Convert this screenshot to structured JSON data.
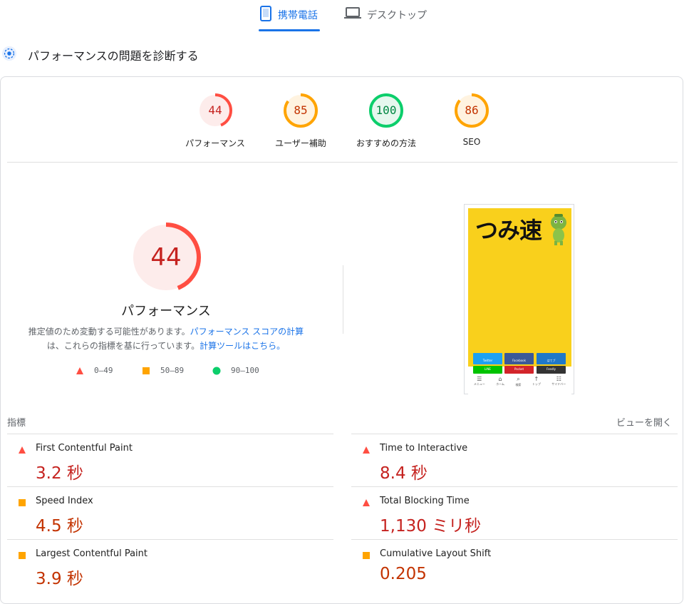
{
  "tabs": {
    "mobile_label": "携帯電話",
    "desktop_label": "デスクトップ"
  },
  "diagnose": {
    "title": "パフォーマンスの問題を診断する"
  },
  "categories": [
    {
      "score": "44",
      "label": "パフォーマンス",
      "rating": "fail",
      "fraction": 0.44
    },
    {
      "score": "85",
      "label": "ユーザー補助",
      "rating": "average",
      "fraction": 0.85
    },
    {
      "score": "100",
      "label": "おすすめの方法",
      "rating": "pass",
      "fraction": 1.0
    },
    {
      "score": "86",
      "label": "SEO",
      "rating": "average",
      "fraction": 0.86
    }
  ],
  "performance": {
    "score": "44",
    "fraction": 0.44,
    "label": "パフォーマンス",
    "desc_line1": "推定値のため変動する可能性があります。",
    "desc_link1": "パフォーマンス スコアの計算",
    "desc_line2": "は、これらの指標を基に行っています。",
    "desc_link2": "計算ツールはこちら。"
  },
  "legend": {
    "fail": "0–49",
    "average": "50–89",
    "pass": "90–100"
  },
  "screenshot": {
    "site_title": "つみ速",
    "share_buttons": [
      "Twitter",
      "Facebook",
      "はてブ",
      "LINE",
      "Pocket",
      "Feedly"
    ],
    "nav": [
      "メニュー",
      "ホーム",
      "検索",
      "トップ",
      "サイドバー"
    ]
  },
  "metrics": {
    "header": "指標",
    "expand_label": "ビューを開く",
    "items": [
      {
        "name": "First Contentful Paint",
        "value": "3.2 秒",
        "rating": "fail"
      },
      {
        "name": "Time to Interactive",
        "value": "8.4 秒",
        "rating": "fail"
      },
      {
        "name": "Speed Index",
        "value": "4.5 秒",
        "rating": "average"
      },
      {
        "name": "Total Blocking Time",
        "value": "1,130 ミリ秒",
        "rating": "fail"
      },
      {
        "name": "Largest Contentful Paint",
        "value": "3.9 秒",
        "rating": "average"
      },
      {
        "name": "Cumulative Layout Shift",
        "value": "0.205",
        "rating": "average"
      }
    ]
  },
  "colors": {
    "fail": "#ff4e42",
    "fail_text": "#c5221f",
    "fail_bg": "#fdeceb",
    "average": "#ffa400",
    "average_text": "#c33300",
    "average_bg": "#fff3e0",
    "pass": "#0cce6b",
    "pass_text": "#018642",
    "pass_bg": "#e6f7ee",
    "accent": "#1a73e8"
  }
}
